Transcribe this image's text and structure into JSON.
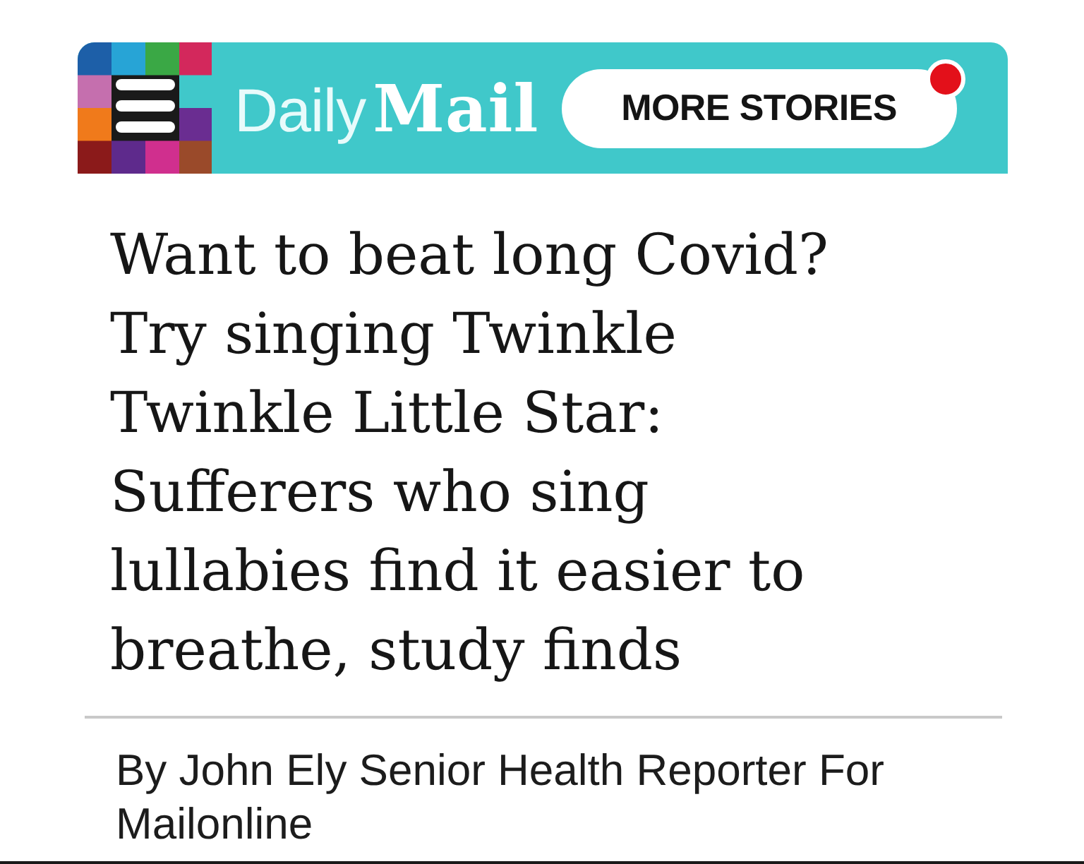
{
  "header": {
    "logo_text": [
      "Daily",
      "Mail"
    ],
    "more_button": {
      "label": "MORE STORIES",
      "notification": true
    }
  },
  "headline": "Want to beat long Covid? Try singing Twinkle Twinkle Little Star: Sufferers who sing lullabies find it easier to breathe, study finds",
  "byline": "By John Ely Senior Health Reporter For Mailonline"
}
